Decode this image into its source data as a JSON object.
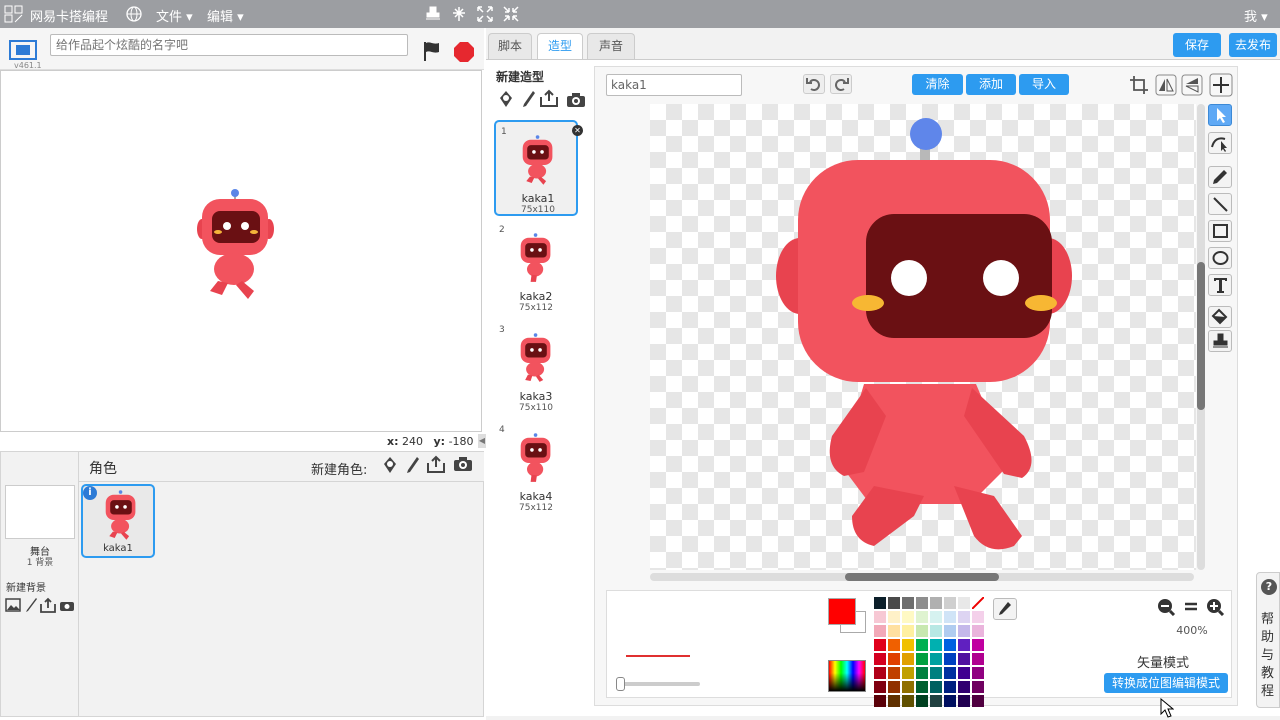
{
  "topbar": {
    "brand": "网易卡搭编程",
    "menu_file": "文件",
    "menu_edit": "编辑",
    "user": "我"
  },
  "stage": {
    "project_placeholder": "给作品起个炫酷的名字吧",
    "version": "v461.1",
    "x_label": "x:",
    "x_value": "240",
    "y_label": "y:",
    "y_value": "-180"
  },
  "sprites_panel": {
    "title": "角色",
    "new_sprite": "新建角色:",
    "stage_label": "舞台",
    "stage_backdrops": "1 背景",
    "new_backdrop": "新建背景",
    "sprite_name": "kaka1"
  },
  "tabs": [
    "脚本",
    "造型",
    "声音"
  ],
  "actions": {
    "save": "保存",
    "publish": "去发布"
  },
  "costumes": {
    "title": "新建造型",
    "items": [
      {
        "num": "1",
        "name": "kaka1",
        "size": "75x110"
      },
      {
        "num": "2",
        "name": "kaka2",
        "size": "75x112"
      },
      {
        "num": "3",
        "name": "kaka3",
        "size": "75x110"
      },
      {
        "num": "4",
        "name": "kaka4",
        "size": "75x112"
      }
    ]
  },
  "editor": {
    "costume_name": "kaka1",
    "clear": "清除",
    "add": "添加",
    "import": "导入",
    "zoom": "400%",
    "mode": "矢量模式",
    "convert": "转换成位图编辑模式",
    "fill_color": "#ff0000"
  },
  "help": {
    "label": "帮助与教程",
    "icon": "?"
  }
}
